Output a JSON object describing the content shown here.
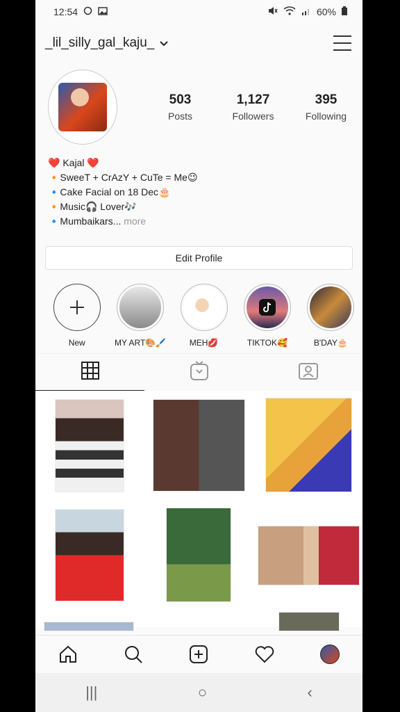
{
  "status": {
    "time": "12:54",
    "battery": "60%"
  },
  "header": {
    "username": "_lil_silly_gal_kaju_",
    "dropdown_icon": "chevron-down-icon",
    "menu_icon": "hamburger-menu-icon"
  },
  "stats": [
    {
      "count": "503",
      "label": "Posts"
    },
    {
      "count": "1,127",
      "label": "Followers"
    },
    {
      "count": "395",
      "label": "Following"
    }
  ],
  "bio": {
    "name_line": "❤️ Kajal ❤️",
    "line1": "🔸SweeT + CrAzY + CuTe = Me😉",
    "line2": "🔹Cake Facial on 18 Dec🎂",
    "line3": "🔸Music🎧 Lover🎶",
    "line4": "🔹Mumbaikars...",
    "more": " more"
  },
  "edit_profile_label": "Edit Profile",
  "highlights": [
    {
      "label": "New"
    },
    {
      "label": "MY ART🎨🖌️"
    },
    {
      "label": "MEH💋"
    },
    {
      "label": "TIKTOK🥰"
    },
    {
      "label": "B'DAY🎂"
    }
  ],
  "tabs": [
    "grid-icon",
    "igtv-icon",
    "tagged-icon"
  ],
  "bottom_nav": [
    "home-icon",
    "search-icon",
    "add-post-icon",
    "heart-icon",
    "profile-avatar"
  ],
  "system_nav": {
    "recents": "|||",
    "home": "○",
    "back": "‹"
  },
  "colors": {
    "background": "#fafafa",
    "text": "#222222",
    "muted": "#999999",
    "accent": "#e0245e"
  }
}
